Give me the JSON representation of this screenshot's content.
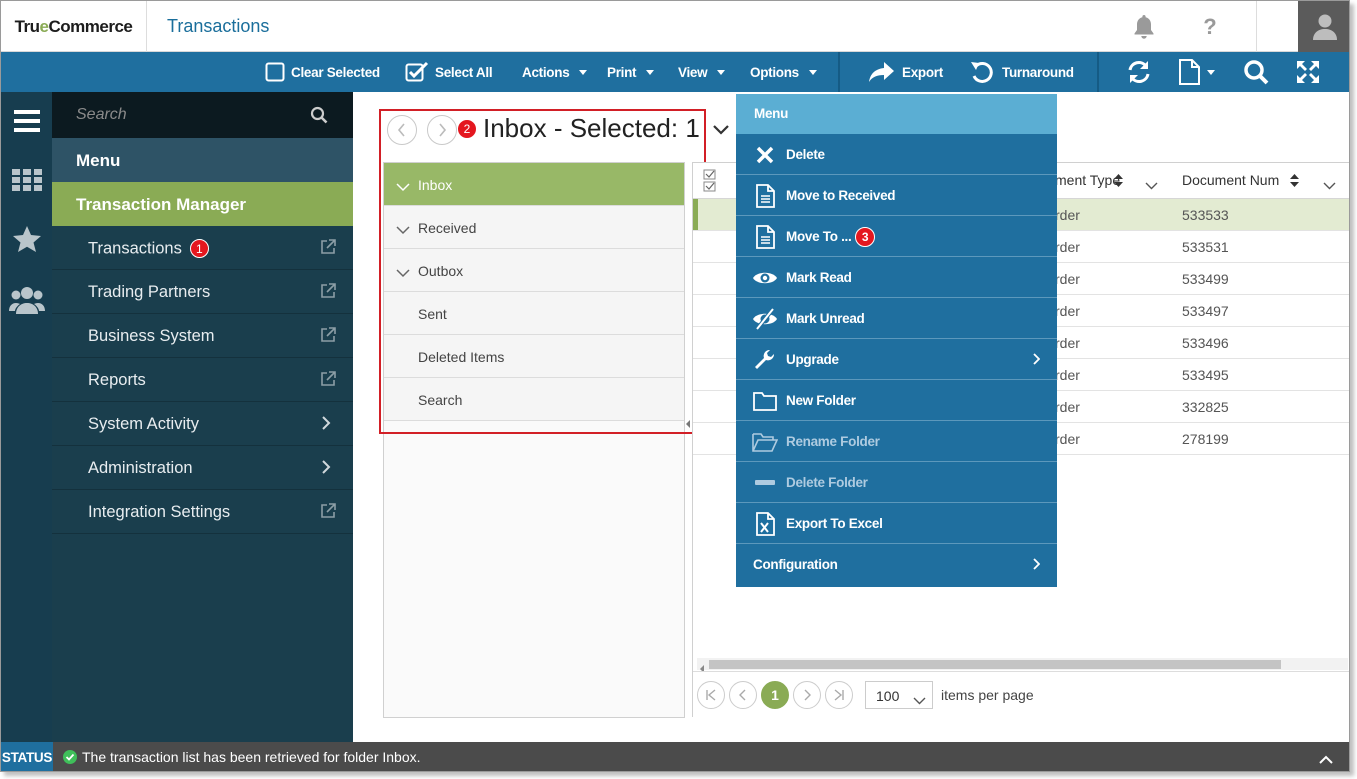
{
  "header": {
    "logo_text_1": "Tru",
    "logo_text_2": "e",
    "logo_text_3": "Commerce",
    "app_title": "Transactions",
    "help_label": "?"
  },
  "toolbar": {
    "clear_selected": "Clear Selected",
    "select_all": "Select All",
    "actions": "Actions",
    "print": "Print",
    "view": "View",
    "options": "Options",
    "export": "Export",
    "turnaround": "Turnaround"
  },
  "nav": {
    "search_placeholder": "Search",
    "menu_label": "Menu",
    "section_label": "Transaction Manager",
    "items": [
      {
        "label": "Transactions",
        "badge": "1"
      },
      {
        "label": "Trading Partners"
      },
      {
        "label": "Business System"
      },
      {
        "label": "Reports"
      },
      {
        "label": "System Activity"
      },
      {
        "label": "Administration"
      },
      {
        "label": "Integration Settings"
      }
    ]
  },
  "main": {
    "folder_title": "Inbox - Selected: 1",
    "callout_2": "2",
    "folders": [
      "Inbox",
      "Received",
      "Outbox",
      "Sent",
      "Deleted Items",
      "Search"
    ],
    "columns": {
      "doc_type": "ment Type",
      "doc_num": "Document Num"
    },
    "rows": [
      {
        "type": "rder",
        "num": "533533"
      },
      {
        "type": "rder",
        "num": "533531"
      },
      {
        "type": "rder",
        "num": "533499"
      },
      {
        "type": "rder",
        "num": "533497"
      },
      {
        "type": "rder",
        "num": "533496"
      },
      {
        "type": "rder",
        "num": "533495"
      },
      {
        "type": "rder",
        "num": "332825"
      },
      {
        "type": "rder",
        "num": "278199"
      }
    ],
    "pager": {
      "current_page": "1",
      "page_size": "100",
      "items_per_page": "items per page"
    }
  },
  "dropdown": {
    "title": "Menu",
    "callout_3": "3",
    "items": [
      {
        "label": "Delete",
        "icon": "close-icon"
      },
      {
        "label": "Move to Received",
        "icon": "document-icon"
      },
      {
        "label": "Move To ...",
        "icon": "document-icon"
      },
      {
        "label": "Mark Read",
        "icon": "eye-icon"
      },
      {
        "label": "Mark Unread",
        "icon": "eye-slash-icon"
      },
      {
        "label": "Upgrade",
        "icon": "wrench-icon",
        "submenu": true
      },
      {
        "label": "New Folder",
        "icon": "folder-icon"
      },
      {
        "label": "Rename Folder",
        "icon": "folder-open-icon",
        "disabled": true
      },
      {
        "label": "Delete Folder",
        "icon": "minus-icon",
        "disabled": true
      },
      {
        "label": "Export To Excel",
        "icon": "excel-icon"
      },
      {
        "label": "Configuration",
        "submenu": true
      }
    ]
  },
  "status": {
    "label": "STATUS",
    "message": "The transaction list has been retrieved for folder Inbox."
  },
  "colors": {
    "primary_blue": "#1f6f9f",
    "accent_green": "#8aab55",
    "nav_dark": "#1a3e4d",
    "alert_red": "#e4171f"
  }
}
